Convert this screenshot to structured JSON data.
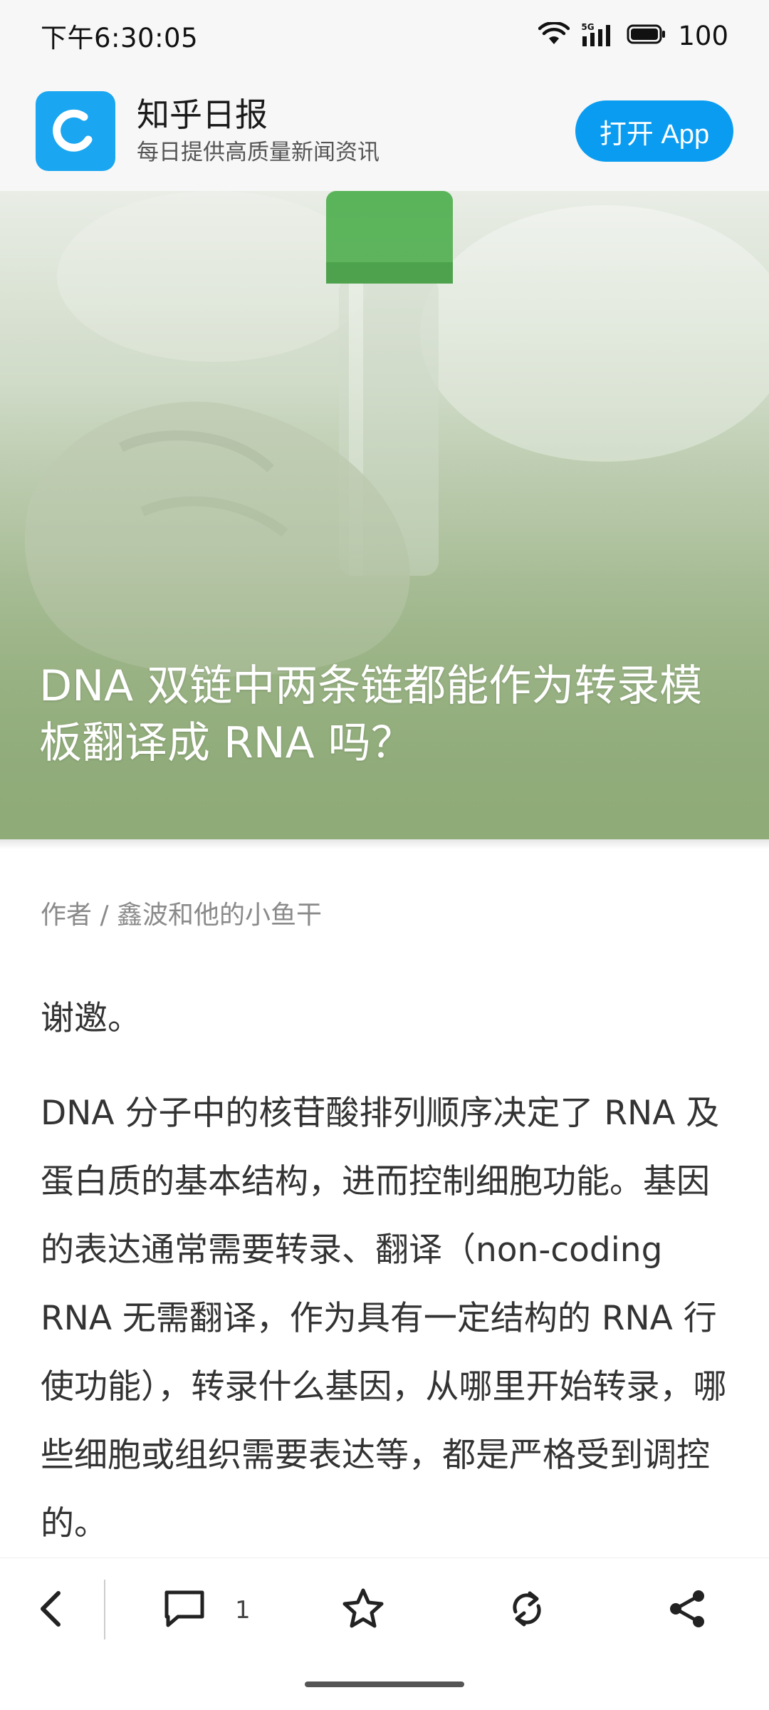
{
  "status_bar": {
    "time": "下午6:30:05",
    "battery": "100",
    "network_label": "5G"
  },
  "header": {
    "app_name": "知乎日报",
    "slogan": "每日提供高质量新闻资讯",
    "open_app_label": "打开 App",
    "accent_color": "#0a9cf0"
  },
  "hero": {
    "title": "DNA 双链中两条链都能作为转录模板翻译成 RNA 吗？"
  },
  "article": {
    "author": "作者 / 鑫波和他的小鱼干",
    "paragraphs": [
      "谢邀。",
      "DNA 分子中的核苷酸排列顺序决定了 RNA 及蛋白质的基本结构，进而控制细胞功能。基因的表达通常需要转录、翻译（non-coding RNA 无需翻译，作为具有一定结构的 RNA 行使功能），转录什么基因，从哪里开始转录，哪些细胞或组织需要表达等，都是严格受到调控的。"
    ]
  },
  "bottom_bar": {
    "comment_count": "1",
    "icons": [
      "back-icon",
      "comment-icon",
      "star-icon",
      "refresh-icon",
      "share-icon"
    ]
  }
}
